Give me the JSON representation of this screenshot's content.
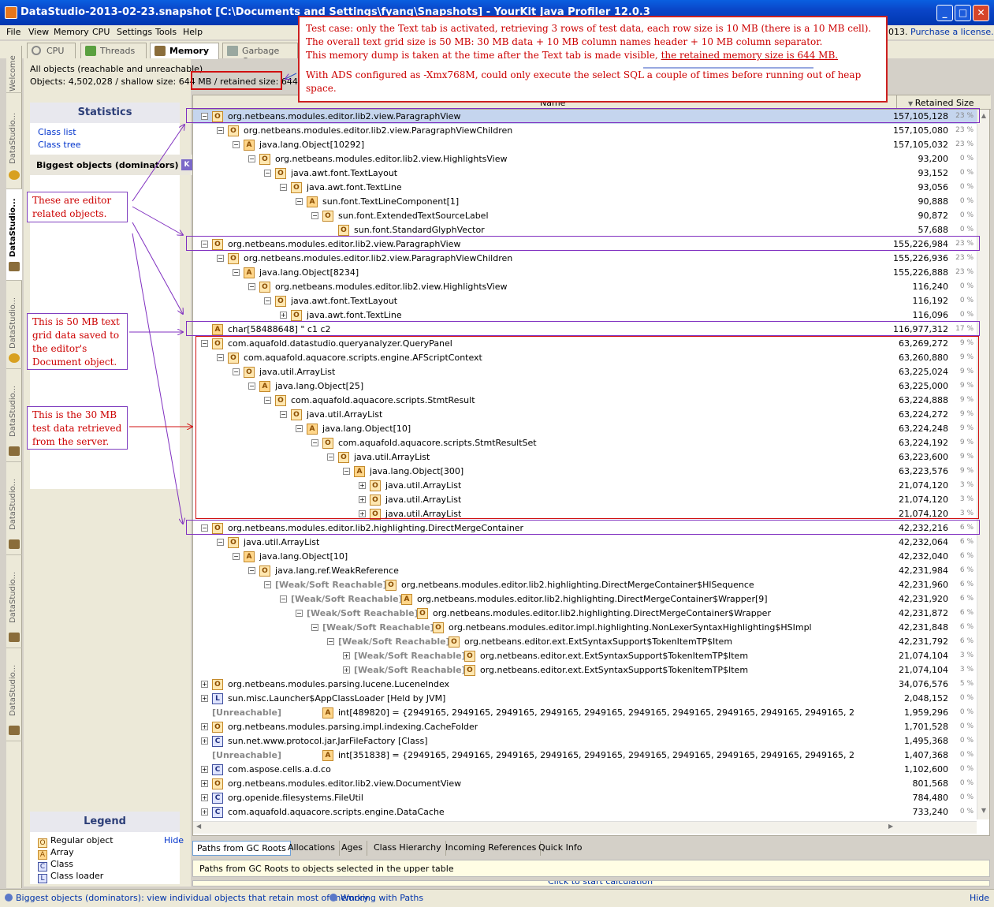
{
  "window": {
    "title": "DataStudio-2013-02-23.snapshot [C:\\Documents and Settings\\fyang\\Snapshots] - YourKit Java Profiler 12.0.3",
    "minimize": "_",
    "maximize": "□",
    "close": "✕"
  },
  "menu": {
    "items": [
      "File",
      "View",
      "Memory",
      "CPU",
      "Settings",
      "Tools",
      "Help"
    ],
    "license_prefix": "013. ",
    "license_link": "Purchase a license."
  },
  "main_tabs": [
    {
      "label": "CPU"
    },
    {
      "label": "Threads"
    },
    {
      "label": "Memory"
    },
    {
      "label": "Garbage Co"
    }
  ],
  "vertical_tabs": [
    "Welcome",
    "DataStudio...",
    "DataStudio...",
    "DataStudio...",
    "DataStudio...",
    "DataStudio...",
    "DataStudio...",
    "DataStudio..."
  ],
  "summary": {
    "line1": "All objects (reachable and unreachable)",
    "line2_prefix": "Objects: 4,502,028 / shallow size: 644 MB",
    "line2_retained": " / retained size: 644 MB"
  },
  "statistics": {
    "title": "Statistics",
    "links": [
      "Class list",
      "Class tree"
    ],
    "biggest": "Biggest objects (dominators)"
  },
  "legend": {
    "title": "Legend",
    "hide": "Hide",
    "items": [
      {
        "badge": "O",
        "label": "Regular object"
      },
      {
        "badge": "A",
        "label": "Array"
      },
      {
        "badge": "C",
        "label": "Class"
      },
      {
        "badge": "L",
        "label": "Class loader"
      }
    ]
  },
  "table": {
    "name_header": "Name",
    "retained_header": "Retained Size",
    "rows": [
      {
        "d": 0,
        "e": "−",
        "b": "O",
        "t": "org.netbeans.modules.editor.lib2.view.ParagraphView",
        "v": "157,105,128",
        "p": "23 %",
        "sel": true
      },
      {
        "d": 1,
        "e": "−",
        "b": "O",
        "t": "org.netbeans.modules.editor.lib2.view.ParagraphViewChildren",
        "v": "157,105,080",
        "p": "23 %"
      },
      {
        "d": 2,
        "e": "−",
        "b": "A",
        "t": "java.lang.Object[10292]",
        "v": "157,105,032",
        "p": "23 %"
      },
      {
        "d": 3,
        "e": "−",
        "b": "O",
        "t": "org.netbeans.modules.editor.lib2.view.HighlightsView",
        "v": "93,200",
        "p": "0 %"
      },
      {
        "d": 4,
        "e": "−",
        "b": "O",
        "t": "java.awt.font.TextLayout",
        "v": "93,152",
        "p": "0 %"
      },
      {
        "d": 5,
        "e": "−",
        "b": "O",
        "t": "java.awt.font.TextLine",
        "v": "93,056",
        "p": "0 %"
      },
      {
        "d": 6,
        "e": "−",
        "b": "A",
        "t": "sun.font.TextLineComponent[1]",
        "v": "90,888",
        "p": "0 %"
      },
      {
        "d": 7,
        "e": "−",
        "b": "O",
        "t": "sun.font.ExtendedTextSourceLabel",
        "v": "90,872",
        "p": "0 %"
      },
      {
        "d": 8,
        "e": "",
        "b": "O",
        "t": "sun.font.StandardGlyphVector",
        "v": "57,688",
        "p": "0 %"
      },
      {
        "d": 0,
        "e": "−",
        "b": "O",
        "t": "org.netbeans.modules.editor.lib2.view.ParagraphView",
        "v": "155,226,984",
        "p": "23 %"
      },
      {
        "d": 1,
        "e": "−",
        "b": "O",
        "t": "org.netbeans.modules.editor.lib2.view.ParagraphViewChildren",
        "v": "155,226,936",
        "p": "23 %"
      },
      {
        "d": 2,
        "e": "−",
        "b": "A",
        "t": "java.lang.Object[8234]",
        "v": "155,226,888",
        "p": "23 %"
      },
      {
        "d": 3,
        "e": "−",
        "b": "O",
        "t": "org.netbeans.modules.editor.lib2.view.HighlightsView",
        "v": "116,240",
        "p": "0 %"
      },
      {
        "d": 4,
        "e": "−",
        "b": "O",
        "t": "java.awt.font.TextLayout",
        "v": "116,192",
        "p": "0 %"
      },
      {
        "d": 5,
        "e": "+",
        "b": "O",
        "t": "java.awt.font.TextLine",
        "v": "116,096",
        "p": "0 %"
      },
      {
        "d": 0,
        "e": "",
        "b": "A",
        "t": "char[58488648] \" c1     c2",
        "v": "116,977,312",
        "p": "17 %"
      },
      {
        "d": 0,
        "e": "−",
        "b": "O",
        "t": "com.aquafold.datastudio.queryanalyzer.QueryPanel",
        "v": "63,269,272",
        "p": "9 %"
      },
      {
        "d": 1,
        "e": "−",
        "b": "O",
        "t": "com.aquafold.aquacore.scripts.engine.AFScriptContext",
        "v": "63,260,880",
        "p": "9 %"
      },
      {
        "d": 2,
        "e": "−",
        "b": "O",
        "t": "java.util.ArrayList",
        "v": "63,225,024",
        "p": "9 %"
      },
      {
        "d": 3,
        "e": "−",
        "b": "A",
        "t": "java.lang.Object[25]",
        "v": "63,225,000",
        "p": "9 %"
      },
      {
        "d": 4,
        "e": "−",
        "b": "O",
        "t": "com.aquafold.aquacore.scripts.StmtResult",
        "v": "63,224,888",
        "p": "9 %"
      },
      {
        "d": 5,
        "e": "−",
        "b": "O",
        "t": "java.util.ArrayList",
        "v": "63,224,272",
        "p": "9 %"
      },
      {
        "d": 6,
        "e": "−",
        "b": "A",
        "t": "java.lang.Object[10]",
        "v": "63,224,248",
        "p": "9 %"
      },
      {
        "d": 7,
        "e": "−",
        "b": "O",
        "t": "com.aquafold.aquacore.scripts.StmtResultSet",
        "v": "63,224,192",
        "p": "9 %"
      },
      {
        "d": 8,
        "e": "−",
        "b": "O",
        "t": "java.util.ArrayList",
        "v": "63,223,600",
        "p": "9 %"
      },
      {
        "d": 9,
        "e": "−",
        "b": "A",
        "t": "java.lang.Object[300]",
        "v": "63,223,576",
        "p": "9 %"
      },
      {
        "d": 10,
        "e": "+",
        "b": "O",
        "t": "java.util.ArrayList",
        "v": "21,074,120",
        "p": "3 %"
      },
      {
        "d": 10,
        "e": "+",
        "b": "O",
        "t": "java.util.ArrayList",
        "v": "21,074,120",
        "p": "3 %"
      },
      {
        "d": 10,
        "e": "+",
        "b": "O",
        "t": "java.util.ArrayList",
        "v": "21,074,120",
        "p": "3 %"
      },
      {
        "d": 0,
        "e": "−",
        "b": "O",
        "t": "org.netbeans.modules.editor.lib2.highlighting.DirectMergeContainer",
        "v": "42,232,216",
        "p": "6 %"
      },
      {
        "d": 1,
        "e": "−",
        "b": "O",
        "t": "java.util.ArrayList",
        "v": "42,232,064",
        "p": "6 %"
      },
      {
        "d": 2,
        "e": "−",
        "b": "A",
        "t": "java.lang.Object[10]",
        "v": "42,232,040",
        "p": "6 %"
      },
      {
        "d": 3,
        "e": "−",
        "b": "O",
        "t": "java.lang.ref.WeakReference",
        "v": "42,231,984",
        "p": "6 %"
      },
      {
        "d": 4,
        "e": "−",
        "w": "[Weak/Soft Reachable]",
        "b": "O",
        "t": "org.netbeans.modules.editor.lib2.highlighting.DirectMergeContainer$HlSequence",
        "v": "42,231,960",
        "p": "6 %"
      },
      {
        "d": 5,
        "e": "−",
        "w": "[Weak/Soft Reachable]",
        "b": "A",
        "t": "org.netbeans.modules.editor.lib2.highlighting.DirectMergeContainer$Wrapper[9]",
        "v": "42,231,920",
        "p": "6 %"
      },
      {
        "d": 6,
        "e": "−",
        "w": "[Weak/Soft Reachable]",
        "b": "O",
        "t": "org.netbeans.modules.editor.lib2.highlighting.DirectMergeContainer$Wrapper",
        "v": "42,231,872",
        "p": "6 %"
      },
      {
        "d": 7,
        "e": "−",
        "w": "[Weak/Soft Reachable]",
        "b": "O",
        "t": "org.netbeans.modules.editor.impl.highlighting.NonLexerSyntaxHighlighting$HSImpl",
        "v": "42,231,848",
        "p": "6 %"
      },
      {
        "d": 8,
        "e": "−",
        "w": "[Weak/Soft Reachable]",
        "b": "O",
        "t": "org.netbeans.editor.ext.ExtSyntaxSupport$TokenItemTP$Item",
        "v": "42,231,792",
        "p": "6 %"
      },
      {
        "d": 9,
        "e": "+",
        "w": "[Weak/Soft Reachable]",
        "b": "O",
        "t": "org.netbeans.editor.ext.ExtSyntaxSupport$TokenItemTP$Item",
        "v": "21,074,104",
        "p": "3 %"
      },
      {
        "d": 9,
        "e": "+",
        "w": "[Weak/Soft Reachable]",
        "b": "O",
        "t": "org.netbeans.editor.ext.ExtSyntaxSupport$TokenItemTP$Item",
        "v": "21,074,104",
        "p": "3 %"
      },
      {
        "d": 0,
        "e": "+",
        "b": "O",
        "t": "org.netbeans.modules.parsing.lucene.LuceneIndex",
        "v": "34,076,576",
        "p": "5 %"
      },
      {
        "d": 0,
        "e": "+",
        "b": "L",
        "t": "sun.misc.Launcher$AppClassLoader [Held by JVM]",
        "v": "2,048,152",
        "p": "0 %"
      },
      {
        "d": 0,
        "e": "",
        "w": "[Unreachable]",
        "b": "A",
        "t": "int[489820] = {2949165, 2949165, 2949165, 2949165, 2949165, 2949165, 2949165, 2949165, 2949165, 2949165, 2949165, 2949165, 2949165, 2949165,",
        "v": "1,959,296",
        "p": "0 %"
      },
      {
        "d": 0,
        "e": "+",
        "b": "O",
        "t": "org.netbeans.modules.parsing.impl.indexing.CacheFolder",
        "v": "1,701,528",
        "p": "0 %"
      },
      {
        "d": 0,
        "e": "+",
        "b": "C",
        "t": "sun.net.www.protocol.jar.JarFileFactory [Class]",
        "v": "1,495,368",
        "p": "0 %"
      },
      {
        "d": 0,
        "e": "",
        "w": "[Unreachable]",
        "b": "A",
        "t": "int[351838] = {2949165, 2949165, 2949165, 2949165, 2949165, 2949165, 2949165, 2949165, 2949165, 2949165, 2949165, 2949165, 2949165, 2949165,",
        "v": "1,407,368",
        "p": "0 %"
      },
      {
        "d": 0,
        "e": "+",
        "b": "C",
        "t": "com.aspose.cells.a.d.co",
        "v": "1,102,600",
        "p": "0 %"
      },
      {
        "d": 0,
        "e": "+",
        "b": "O",
        "t": "org.netbeans.modules.editor.lib2.view.DocumentView",
        "v": "801,568",
        "p": "0 %"
      },
      {
        "d": 0,
        "e": "+",
        "b": "C",
        "t": "org.openide.filesystems.FileUtil",
        "v": "784,480",
        "p": "0 %"
      },
      {
        "d": 0,
        "e": "+",
        "b": "C",
        "t": "com.aquafold.aquacore.scripts.engine.DataCache",
        "v": "733,240",
        "p": "0 %"
      }
    ]
  },
  "bottom_tabs": [
    "Paths from GC Roots",
    "Allocations",
    "Ages",
    "Class Hierarchy",
    "Incoming References",
    "Quick Info"
  ],
  "paths_message": "Paths from GC Roots to objects selected in the upper table",
  "calc_link": "Click to start calculation",
  "status": {
    "left": "Biggest objects (dominators): view individual objects that retain most of memory",
    "middle": "Working with Paths",
    "right": "Hide"
  },
  "annotations": {
    "big_note": [
      "Test case: only the Text tab is activated, retrieving 3 rows of test data, each row size is 10 MB (there is a 10 MB cell).",
      "The overall text grid size is 50 MB: 30 MB data + 10 MB column names header + 10 MB column separator.",
      "This memory dump is taken at the time after the Text tab is made visible, ",
      "the retained memory size is 644 MB.",
      "With ADS configured as -Xmx768M, could only execute the select SQL a couple of times before running out of heap space."
    ],
    "editor_note": "These are editor related objects.",
    "grid_note": "This is 50 MB text grid data saved to the editor's Document object.",
    "server_note": "This is the 30 MB test data retrieved from the server."
  }
}
